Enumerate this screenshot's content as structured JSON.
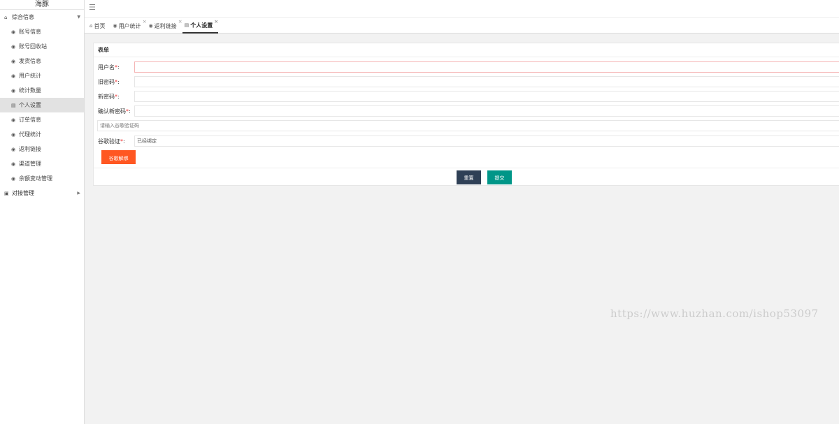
{
  "sidebar": {
    "logo": "海豚",
    "groups": [
      {
        "label": "综合信息",
        "icon": "home-icon",
        "expanded": true
      },
      {
        "label": "对接管理",
        "icon": "image-icon",
        "expanded": false
      }
    ],
    "items": [
      {
        "label": "账号信息",
        "icon": "user-icon"
      },
      {
        "label": "账号回收站",
        "icon": "user-icon"
      },
      {
        "label": "发货信息",
        "icon": "user-icon"
      },
      {
        "label": "用户统计",
        "icon": "user-icon"
      },
      {
        "label": "统计数量",
        "icon": "user-icon"
      },
      {
        "label": "个人设置",
        "icon": "list-icon",
        "active": true
      },
      {
        "label": "订单信息",
        "icon": "user-icon"
      },
      {
        "label": "代理统计",
        "icon": "user-icon"
      },
      {
        "label": "返利链接",
        "icon": "user-icon"
      },
      {
        "label": "渠道管理",
        "icon": "user-icon"
      },
      {
        "label": "余额变动管理",
        "icon": "user-icon"
      }
    ]
  },
  "tabs": [
    {
      "label": "首页",
      "icon": "home-icon",
      "closable": false
    },
    {
      "label": "用户统计",
      "icon": "user-icon",
      "closable": true
    },
    {
      "label": "返利链接",
      "icon": "user-icon",
      "closable": true
    },
    {
      "label": "个人设置",
      "icon": "list-icon",
      "closable": true,
      "active": true
    }
  ],
  "form": {
    "title": "表单",
    "username_label": "用户名",
    "old_password_label": "旧密码",
    "new_password_label": "新密码",
    "confirm_password_label": "确认新密码",
    "google_code_placeholder": "请输入谷歌验证码",
    "google_verify_label": "谷歌验证",
    "google_verify_value": "已经绑定",
    "required_mark": "*",
    "colon": ":",
    "unbind_button": "谷歌解绑",
    "reset_button": "重置",
    "submit_button": "提交"
  },
  "watermark": "https://www.huzhan.com/ishop53097",
  "colors": {
    "unbind": "#ff5722",
    "reset": "#2f4056",
    "submit": "#009688",
    "active_menu": "#e2e2e2"
  }
}
